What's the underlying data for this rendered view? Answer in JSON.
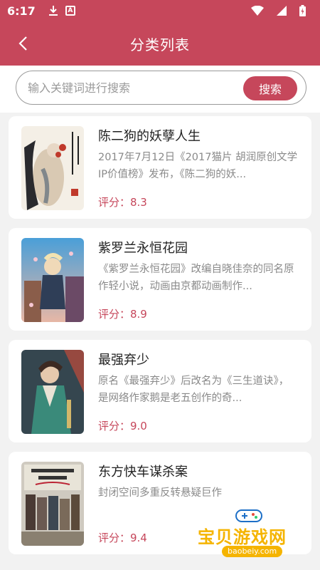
{
  "status_bar": {
    "time": "6:17",
    "icons": [
      "download-icon",
      "a-app-icon",
      "wifi-icon",
      "signal-icon",
      "battery-icon"
    ]
  },
  "app_bar": {
    "title": "分类列表",
    "back_icon": "back-chevron-icon",
    "color": "#c6475b"
  },
  "search": {
    "placeholder": "输入关键词进行搜索",
    "value": "",
    "button_label": "搜索"
  },
  "books": [
    {
      "title": "陈二狗的妖孽人生",
      "description": "2017年7月12日《2017猫片 胡润原创文学IP价值榜》发布，《陈二狗的妖...",
      "score": "评分：8.3"
    },
    {
      "title": "紫罗兰永恒花园",
      "description": "《紫罗兰永恒花园》改编自晓佳奈的同名原作轻小说，动画由京都动画制作...",
      "score": "评分：8.9"
    },
    {
      "title": "最强弃少",
      "description": "原名《最强弃少》后改名为《三生道诀》，是网络作家鹅是老五创作的奇...",
      "score": "评分：9.0"
    },
    {
      "title": "东方快车谋杀案",
      "description": "封闭空间多重反转悬疑巨作",
      "score": "评分：9.4"
    }
  ],
  "watermark": {
    "text": "宝贝游戏网",
    "url": "baobeiy.com"
  }
}
